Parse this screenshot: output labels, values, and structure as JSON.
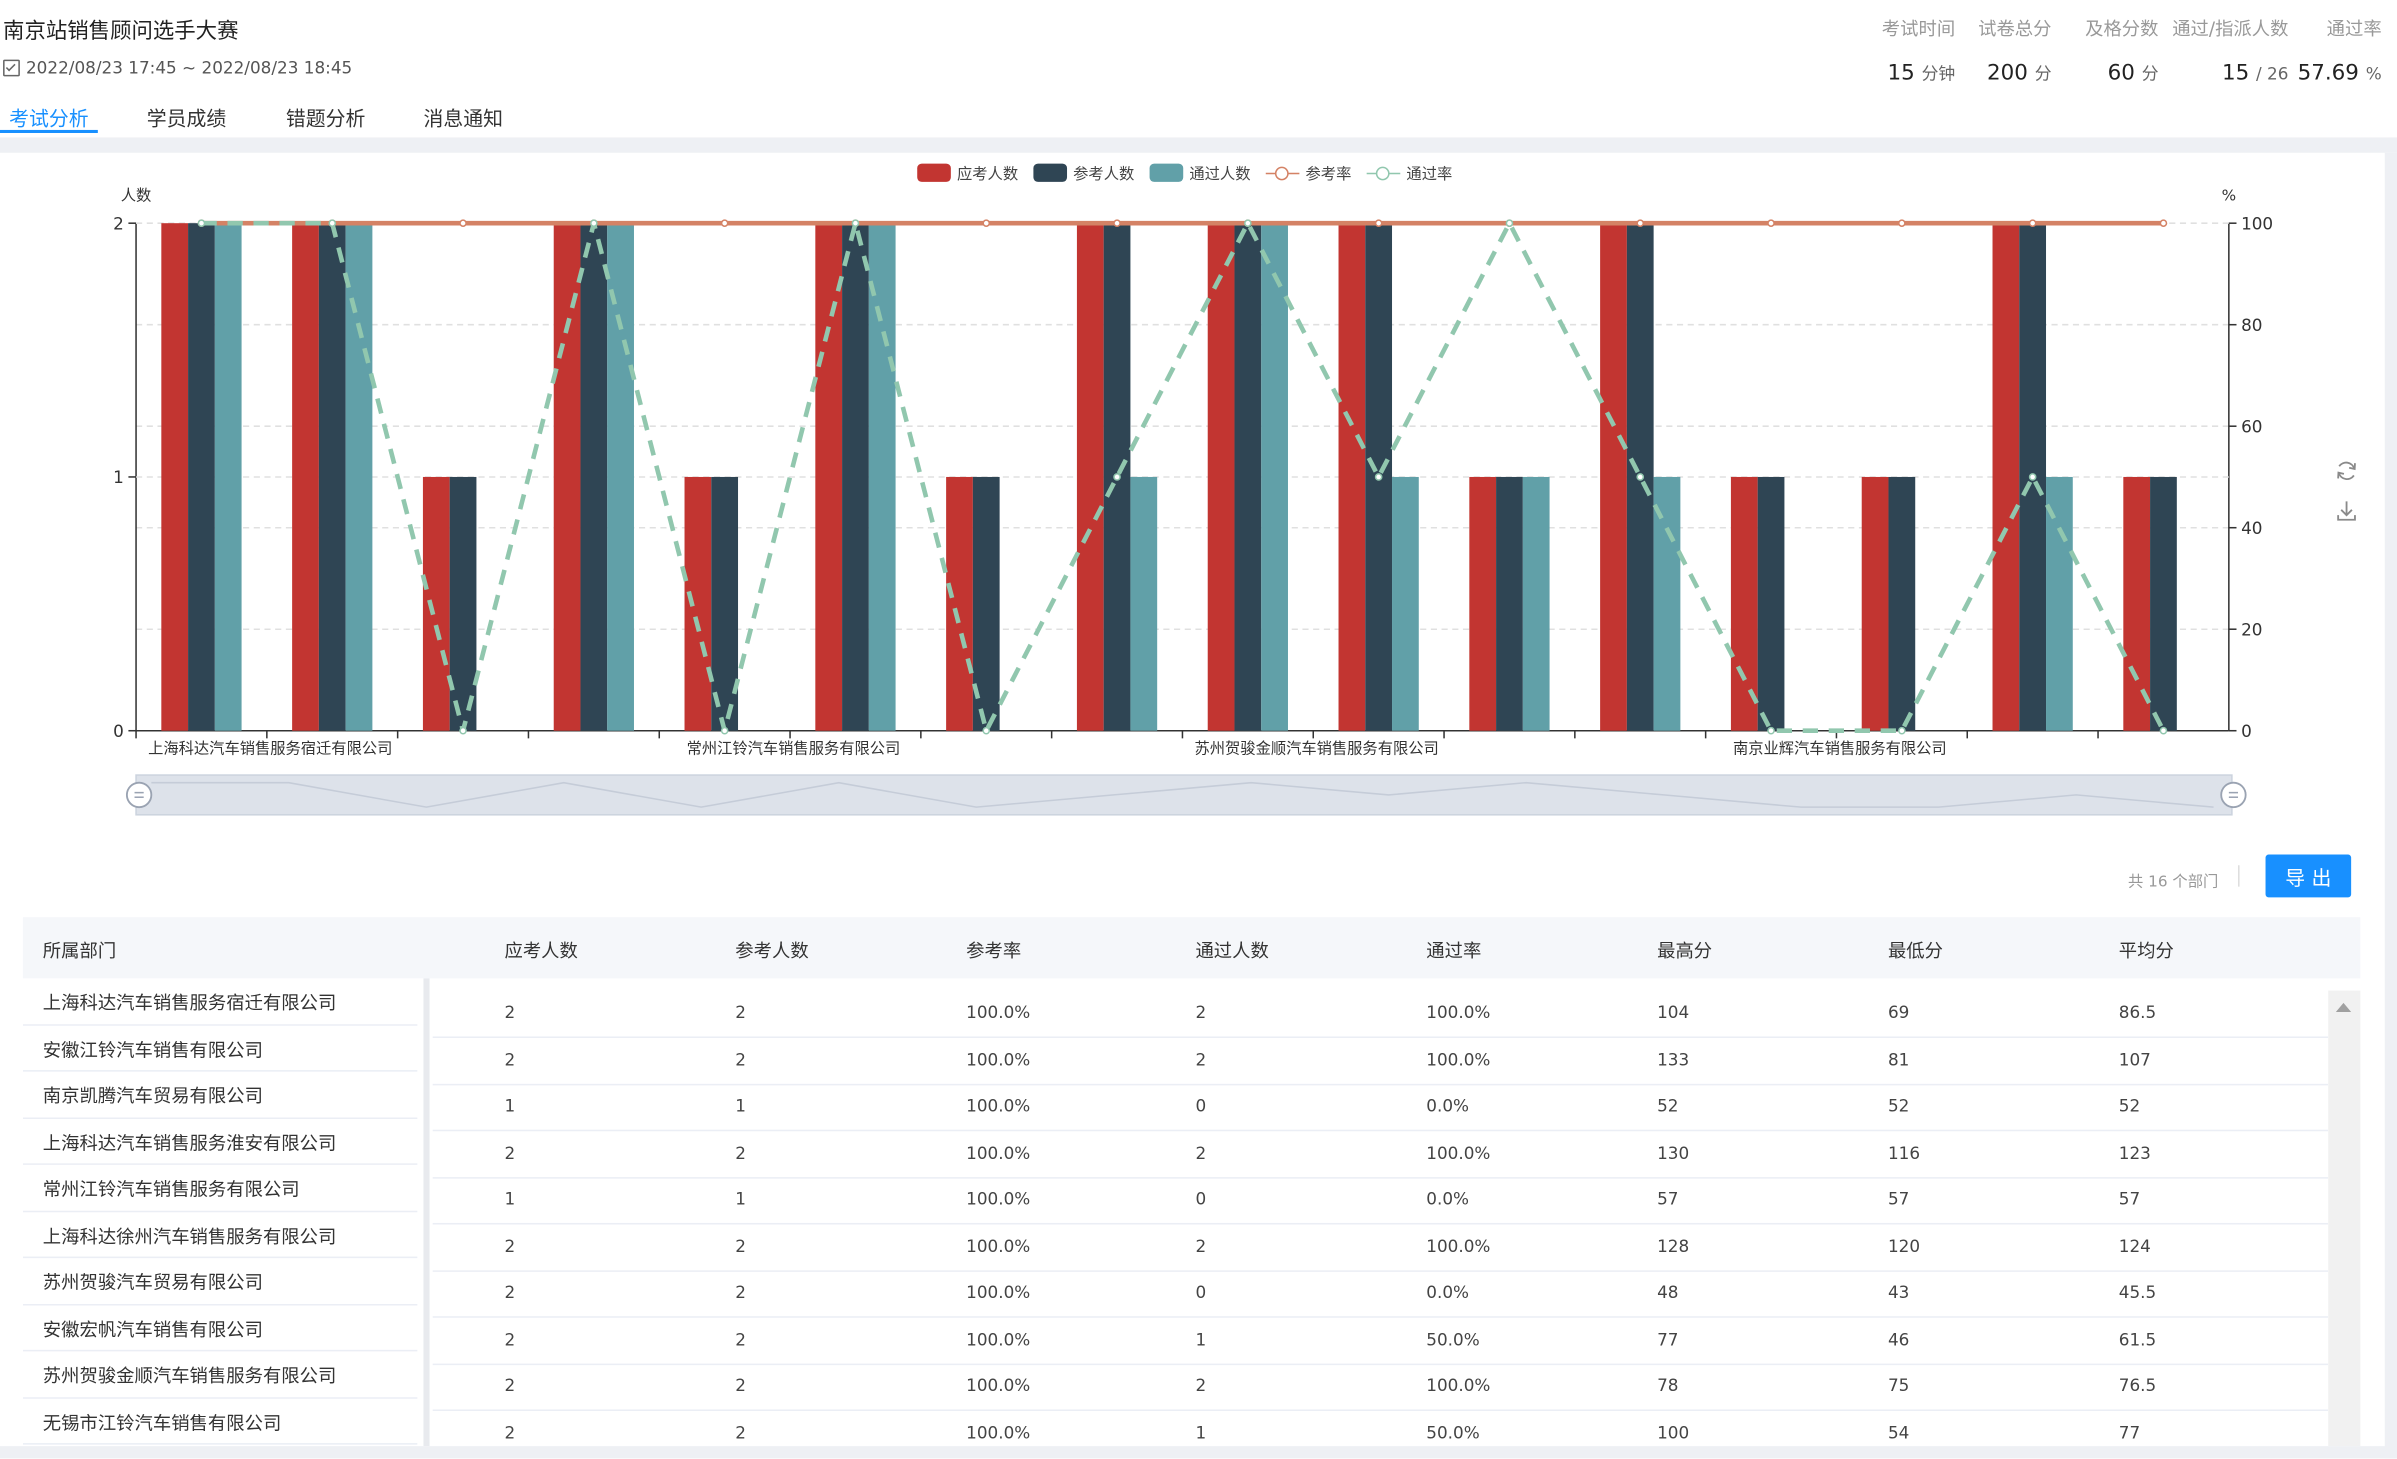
{
  "header": {
    "title": "南京站销售顾问选手大赛",
    "time_range": "2022/08/23 17:45 ~ 2022/08/23 18:45"
  },
  "stats": [
    {
      "label": "考试时间",
      "value": "15",
      "unit": "分钟"
    },
    {
      "label": "试卷总分",
      "value": "200",
      "unit": "分"
    },
    {
      "label": "及格分数",
      "value": "60",
      "unit": "分"
    },
    {
      "label": "通过/指派人数",
      "value": "15",
      "unit": "/ 26"
    },
    {
      "label": "通过率",
      "value": "57.69",
      "unit": "%"
    }
  ],
  "tabs": [
    {
      "label": "考试分析",
      "active": true
    },
    {
      "label": "学员成绩",
      "active": false
    },
    {
      "label": "错题分析",
      "active": false
    },
    {
      "label": "消息通知",
      "active": false
    }
  ],
  "icons": {
    "calendar": "calendar-check-icon",
    "refresh": "refresh-icon",
    "download": "download-icon",
    "scroll_up": "arrow-up-icon"
  },
  "colors": {
    "accent": "#1890ff",
    "series_a": "#c23531",
    "series_b": "#2f4554",
    "series_c": "#61a0a8",
    "rate_a": "#d48265",
    "rate_b": "#91c7ae"
  },
  "chart_data": {
    "type": "bar",
    "legend": [
      "应考人数",
      "参考人数",
      "通过人数",
      "参考率",
      "通过率"
    ],
    "ylabel_left": "人数",
    "ylabel_right": "%",
    "ylim_left": [
      0,
      2
    ],
    "ylim_right": [
      0,
      100
    ],
    "yticks_left": [
      "0",
      "1",
      "2"
    ],
    "yticks_right": [
      "0",
      "20",
      "40",
      "60",
      "80",
      "100"
    ],
    "x_axis_labels": [
      "上海科达汽车销售服务宿迁有限公司",
      "常州江铃汽车销售服务有限公司",
      "苏州贺骏金顺汽车销售服务有限公司",
      "南京业辉汽车销售服务有限公司"
    ],
    "label_indices": [
      0,
      4,
      8,
      12
    ],
    "categories_count": 16,
    "series": [
      {
        "name": "应考人数",
        "kind": "bar",
        "color": "#c23531",
        "values": [
          2,
          2,
          1,
          2,
          1,
          2,
          1,
          2,
          2,
          2,
          1,
          2,
          1,
          1,
          2,
          1
        ]
      },
      {
        "name": "参考人数",
        "kind": "bar",
        "color": "#2f4554",
        "values": [
          2,
          2,
          1,
          2,
          1,
          2,
          1,
          2,
          2,
          2,
          1,
          2,
          1,
          1,
          2,
          1
        ]
      },
      {
        "name": "通过人数",
        "kind": "bar",
        "color": "#61a0a8",
        "values": [
          2,
          2,
          0,
          2,
          0,
          2,
          0,
          1,
          2,
          1,
          1,
          1,
          0,
          0,
          1,
          0
        ]
      },
      {
        "name": "参考率",
        "kind": "line",
        "color": "#d48265",
        "values": [
          100,
          100,
          100,
          100,
          100,
          100,
          100,
          100,
          100,
          100,
          100,
          100,
          100,
          100,
          100,
          100
        ]
      },
      {
        "name": "通过率",
        "kind": "line",
        "color": "#91c7ae",
        "values": [
          100,
          100,
          0,
          100,
          0,
          100,
          0,
          50,
          100,
          50,
          100,
          50,
          0,
          0,
          50,
          0
        ]
      }
    ],
    "grid": true,
    "legend_position": "top-center"
  },
  "toolbar": {
    "count_text": "共 16 个部门",
    "export_label": "导 出"
  },
  "table": {
    "headers": [
      "所属部门",
      "应考人数",
      "参考人数",
      "参考率",
      "通过人数",
      "通过率",
      "最高分",
      "最低分",
      "平均分"
    ],
    "departments": [
      "上海科达汽车销售服务宿迁有限公司",
      "安徽江铃汽车销售有限公司",
      "南京凯腾汽车贸易有限公司",
      "上海科达汽车销售服务淮安有限公司",
      "常州江铃汽车销售服务有限公司",
      "上海科达徐州汽车销售服务有限公司",
      "苏州贺骏汽车贸易有限公司",
      "安徽宏帆汽车销售有限公司",
      "苏州贺骏金顺汽车销售服务有限公司",
      "无锡市江铃汽车销售有限公司"
    ],
    "rows": [
      [
        "2",
        "2",
        "100.0%",
        "2",
        "100.0%",
        "104",
        "69",
        "86.5"
      ],
      [
        "2",
        "2",
        "100.0%",
        "2",
        "100.0%",
        "133",
        "81",
        "107"
      ],
      [
        "1",
        "1",
        "100.0%",
        "0",
        "0.0%",
        "52",
        "52",
        "52"
      ],
      [
        "2",
        "2",
        "100.0%",
        "2",
        "100.0%",
        "130",
        "116",
        "123"
      ],
      [
        "1",
        "1",
        "100.0%",
        "0",
        "0.0%",
        "57",
        "57",
        "57"
      ],
      [
        "2",
        "2",
        "100.0%",
        "2",
        "100.0%",
        "128",
        "120",
        "124"
      ],
      [
        "2",
        "2",
        "100.0%",
        "0",
        "0.0%",
        "48",
        "43",
        "45.5"
      ],
      [
        "2",
        "2",
        "100.0%",
        "1",
        "50.0%",
        "77",
        "46",
        "61.5"
      ],
      [
        "2",
        "2",
        "100.0%",
        "2",
        "100.0%",
        "78",
        "75",
        "76.5"
      ],
      [
        "2",
        "2",
        "100.0%",
        "1",
        "50.0%",
        "100",
        "54",
        "77"
      ]
    ]
  }
}
